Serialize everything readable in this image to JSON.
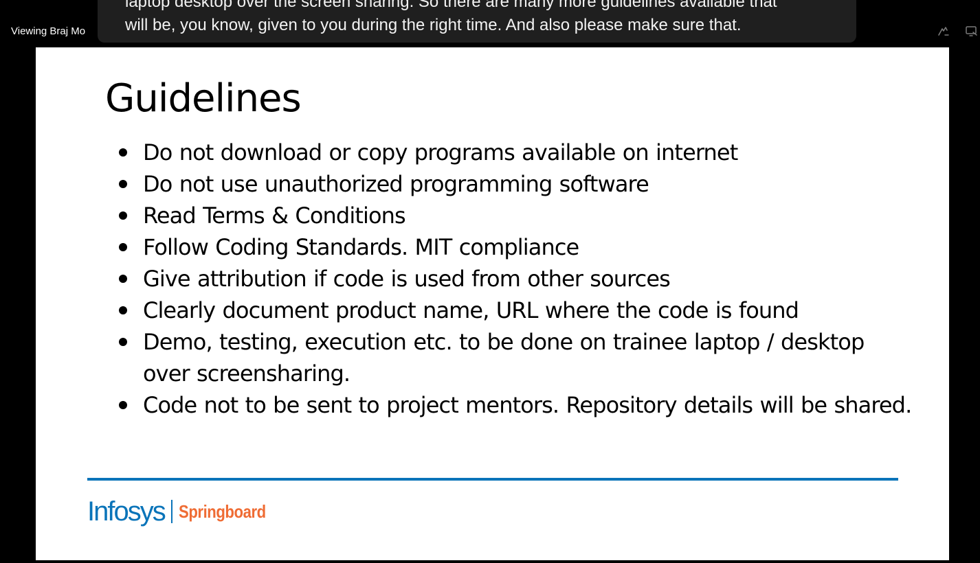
{
  "meeting_bar": {
    "viewing_label": "Viewing Braj Mo",
    "pen_icon": "pen-annotate-icon",
    "share_icon": "screen-share-icon"
  },
  "caption": {
    "line_1": "laptop desktop over the screen sharing. So there are many more guidelines available that",
    "line_2": "will be, you know, given to you during the right time. And also please make sure that."
  },
  "slide": {
    "title": "Guidelines",
    "bullets": [
      "Do not download or copy programs available on internet",
      "Do not use unauthorized programming software",
      "Read Terms & Conditions",
      "Follow Coding Standards. MIT compliance",
      "Give attribution if code is used from other sources",
      "Clearly document product name, URL where the code is found",
      "Demo, testing, execution etc. to be done on trainee laptop / desktop over screensharing.",
      "Code not to be sent to project mentors. Repository details will be shared."
    ],
    "footer": {
      "brand": "Infosys",
      "product": "Springboard"
    }
  },
  "colors": {
    "background": "#000000",
    "caption_bg": "#1f1f1f",
    "slide_bg": "#ffffff",
    "accent_blue": "#0a74b9",
    "springboard_orange": "#ef6c34"
  }
}
